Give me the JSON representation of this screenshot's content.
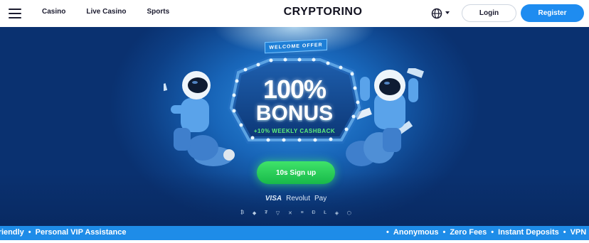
{
  "header": {
    "logo": "CRYPTORINO",
    "nav": [
      "Casino",
      "Live Casino",
      "Sports"
    ],
    "login_label": "Login",
    "register_label": "Register",
    "menu_icon": "hamburger-icon",
    "language_icon": "globe-icon"
  },
  "hero": {
    "ribbon": "WELCOME OFFER",
    "bonus_line1": "100%",
    "bonus_line2": "BONUS",
    "cashback": "+10% WEEKLY CASHBACK",
    "cta_label": "10s Sign up",
    "payment_methods": [
      "VISA",
      "Revolut",
      "Pay"
    ],
    "crypto_icons": [
      "bitcoin-icon",
      "ethereum-icon",
      "tether-icon",
      "tron-icon",
      "xrp-icon",
      "solana-icon",
      "dogecoin-icon",
      "litecoin-icon",
      "bnb-icon",
      "chainlink-icon"
    ],
    "colors": {
      "accent_blue": "#1e8cf0",
      "cta_green": "#18b94a",
      "cashback_green": "#5ef07a"
    }
  },
  "ticker": {
    "left_items": [
      "Friendly",
      "Personal VIP Assistance"
    ],
    "right_items": [
      "Anonymous",
      "Zero Fees",
      "Instant Deposits",
      "VPN F"
    ]
  }
}
